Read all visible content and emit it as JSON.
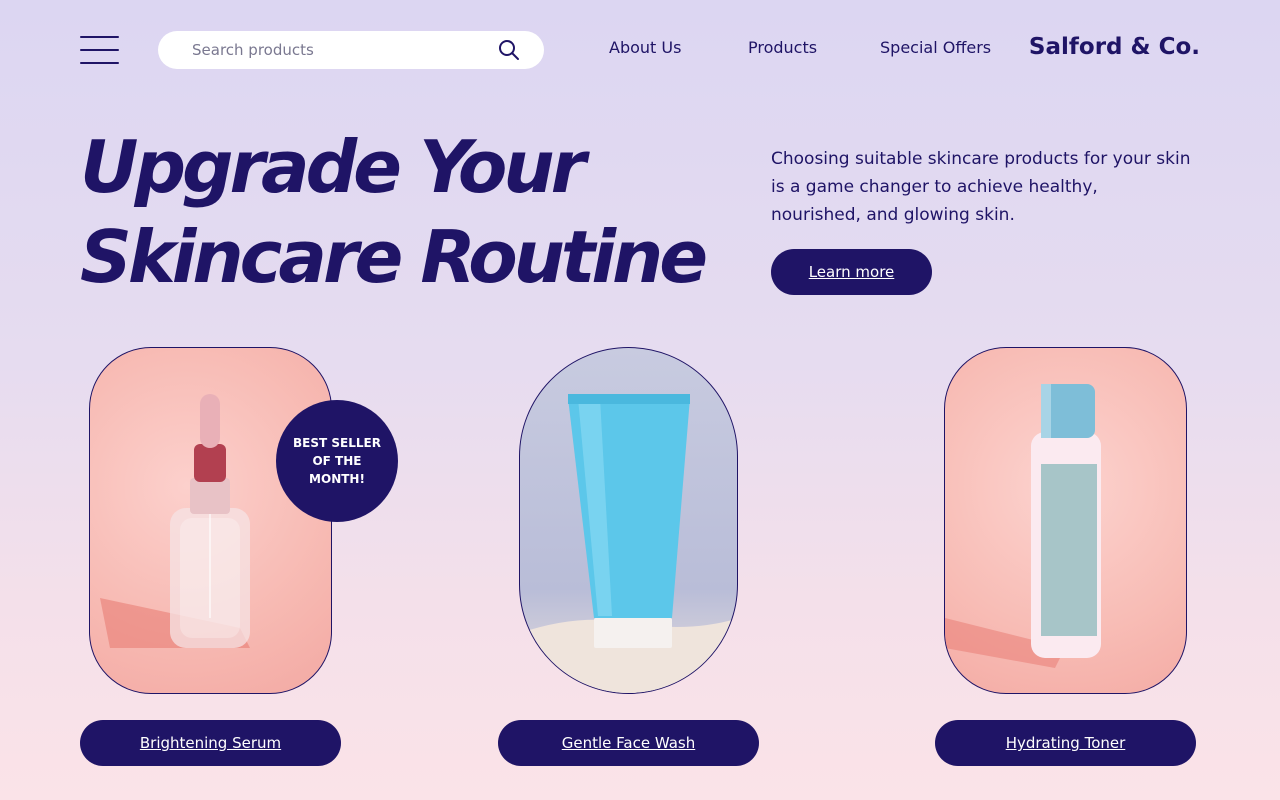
{
  "header": {
    "search_placeholder": "Search products",
    "nav": {
      "about": "About Us",
      "products": "Products",
      "offers": "Special Offers"
    },
    "brand": "Salford & Co."
  },
  "hero": {
    "title_line1": "Upgrade Your",
    "title_line2": "Skincare Routine",
    "description": "Choosing suitable skincare products for your skin is a game changer to achieve healthy, nourished, and glowing skin.",
    "cta_label": "Learn more"
  },
  "products": {
    "badge": "BEST SELLER OF THE MONTH!",
    "items": [
      {
        "label": "Brightening Serum"
      },
      {
        "label": "Gentle Face Wash"
      },
      {
        "label": "Hydrating Toner"
      }
    ]
  },
  "colors": {
    "primary": "#1f1466",
    "white": "#ffffff",
    "bg_top": "#dcd6f2",
    "bg_bottom": "#fbe3e8"
  },
  "icons": [
    "menu-icon",
    "search-icon"
  ]
}
